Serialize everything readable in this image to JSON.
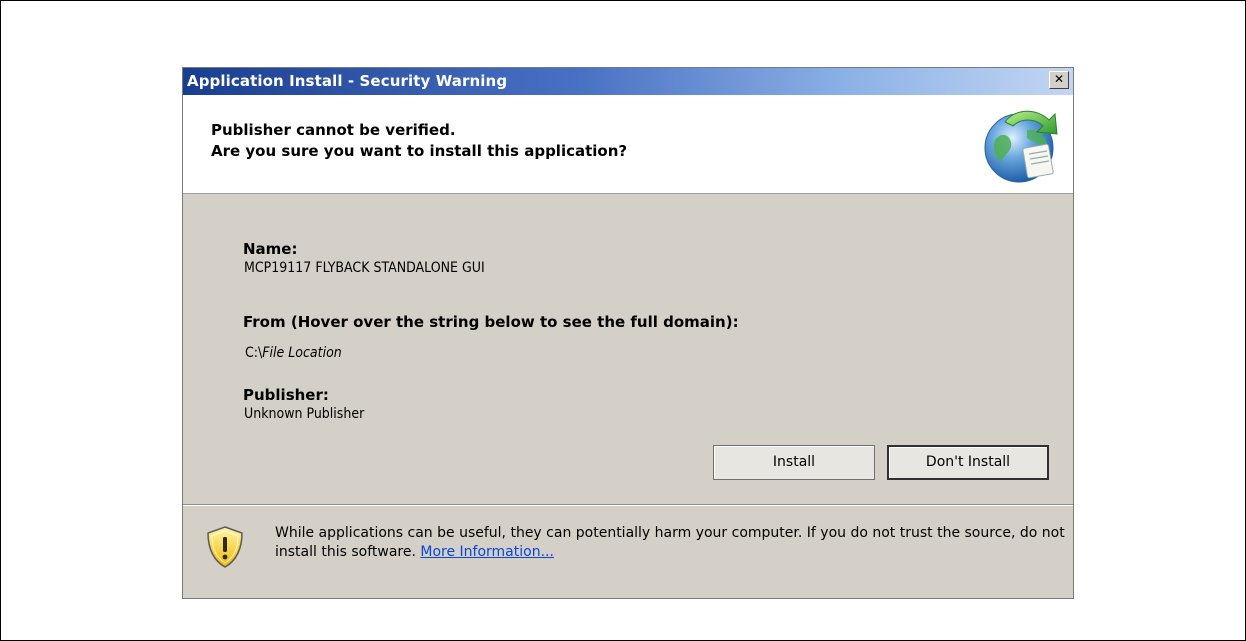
{
  "dialog": {
    "title": "Application Install - Security Warning",
    "close_label": "✕"
  },
  "header": {
    "line1": "Publisher cannot be verified.",
    "line2": "Are you sure you want to install this application?",
    "icon": "globe-install-icon"
  },
  "details": {
    "name_label": "Name:",
    "name_value": "MCP19117 FLYBACK STANDALONE GUI",
    "from_label": "From (Hover over the string below to see the full domain):",
    "from_prefix": "C:\\",
    "from_value": "File Location",
    "publisher_label": "Publisher:",
    "publisher_value": "Unknown Publisher"
  },
  "buttons": {
    "install": "Install",
    "dont_install": "Don't Install"
  },
  "footer": {
    "icon": "shield-warning-icon",
    "warning_text": "While applications can be useful, they can potentially harm your computer. If you do not trust the source, do not install this software. ",
    "more_info_link": "More Information..."
  },
  "colors": {
    "titlebar_start": "#1a3e8f",
    "titlebar_end": "#c2d6f2",
    "dialog_bg": "#d4d0c8",
    "link": "#0a46d8"
  }
}
